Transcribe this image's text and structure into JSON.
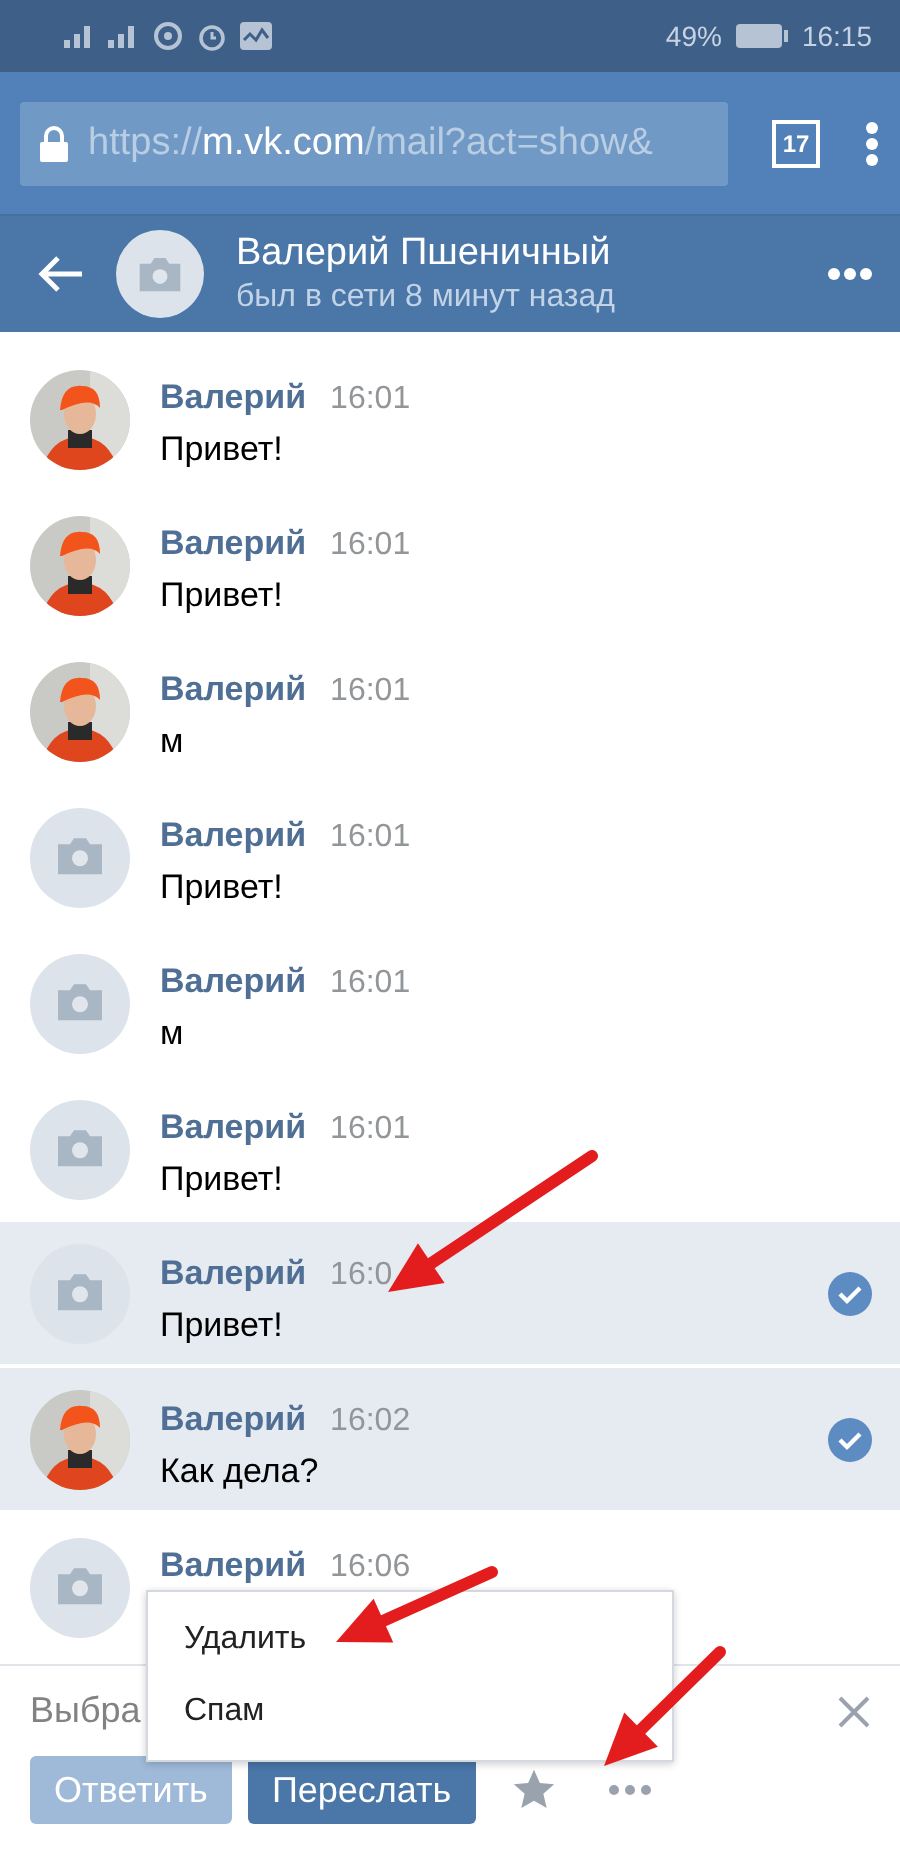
{
  "status_bar": {
    "battery": "49%",
    "time": "16:15"
  },
  "browser": {
    "url": "https://**m.vk.com**/mail?act=show&",
    "tab_count": "17"
  },
  "header": {
    "title": "Валерий Пшеничный",
    "subtitle": "был в сети 8 минут назад"
  },
  "messages": [
    {
      "author": "Валерий",
      "time": "16:01",
      "text": "Привет!",
      "selected": false
    },
    {
      "author": "Валерий",
      "time": "16:01",
      "text": "Привет!",
      "selected": false
    },
    {
      "author": "Валерий",
      "time": "16:01",
      "text": "м",
      "selected": false
    },
    {
      "kind": "placeholder",
      "author": "Валерий",
      "time": "16:01",
      "text": "Привет!",
      "selected": false
    },
    {
      "kind": "placeholder",
      "author": "Валерий",
      "time": "16:01",
      "text": "м",
      "selected": false
    },
    {
      "kind": "placeholder",
      "author": "Валерий",
      "time": "16:01",
      "text": "Привет!",
      "selected": false
    },
    {
      "kind": "placeholder",
      "author": "Валерий",
      "time": "16:0",
      "text": "Привет!",
      "selected": true
    },
    {
      "author": "Валерий",
      "time": "16:02",
      "text": "Как дела?",
      "selected": true
    },
    {
      "kind": "placeholder",
      "author": "Валерий",
      "time": "16:06",
      "selected": false
    }
  ],
  "action_bar": {
    "label": "Выбра",
    "buttons": [
      {
        "label": "Ответить",
        "disabled": true
      },
      {
        "label": "Переслать",
        "disabled": false
      }
    ]
  },
  "menu": {
    "items": [
      "Удалить",
      "Спам"
    ]
  }
}
